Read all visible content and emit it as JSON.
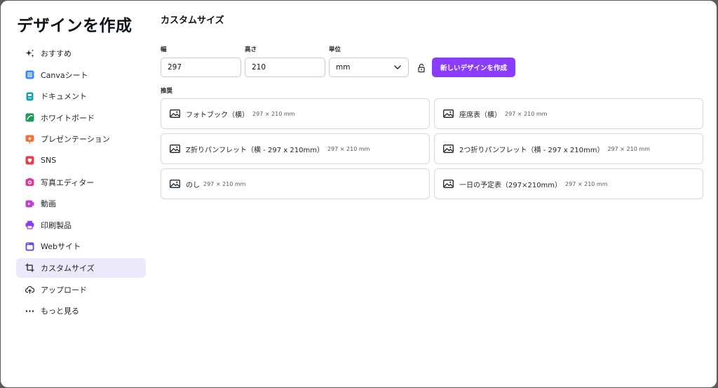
{
  "header": {
    "title": "デザインを作成"
  },
  "sidebar": {
    "items": [
      {
        "label": "おすすめ",
        "icon": "sparkle-icon",
        "color": "#1e2328"
      },
      {
        "label": "Canvaシート",
        "icon": "sheet-icon",
        "color": "#3a86ff"
      },
      {
        "label": "ドキュメント",
        "icon": "doc-icon",
        "color": "#13a3b8"
      },
      {
        "label": "ホワイトボード",
        "icon": "whiteboard-icon",
        "color": "#1e9b5a"
      },
      {
        "label": "プレゼンテーション",
        "icon": "presentation-icon",
        "color": "#f2703a"
      },
      {
        "label": "SNS",
        "icon": "heart-icon",
        "color": "#f0384e"
      },
      {
        "label": "写真エディター",
        "icon": "camera-icon",
        "color": "#e0389a"
      },
      {
        "label": "動画",
        "icon": "video-icon",
        "color": "#c23bd9"
      },
      {
        "label": "印刷製品",
        "icon": "printer-icon",
        "color": "#8b3dff"
      },
      {
        "label": "Webサイト",
        "icon": "website-icon",
        "color": "#5b4be0"
      },
      {
        "label": "カスタムサイズ",
        "icon": "crop-icon",
        "color": "#1e2328",
        "active": true
      },
      {
        "label": "アップロード",
        "icon": "cloud-upload-icon",
        "color": "#1e2328"
      },
      {
        "label": "もっと見る",
        "icon": "more-icon",
        "color": "#1e2328"
      }
    ]
  },
  "custom": {
    "title": "カスタムサイズ",
    "width_label": "幅",
    "width_value": "297",
    "height_label": "高さ",
    "height_value": "210",
    "unit_label": "単位",
    "unit_value": "mm",
    "create_label": "新しいデザインを作成",
    "recommended_label": "推奨"
  },
  "recommendations": [
    {
      "name": "フォトブック（横）",
      "size": "297 × 210 mm"
    },
    {
      "name": "座席表（横）",
      "size": "297 × 210 mm"
    },
    {
      "name": "Z折りパンフレット（横 - 297 x 210mm）",
      "size": "297 × 210 mm"
    },
    {
      "name": "2つ折りパンフレット（横 - 297 x 210mm）",
      "size": "297 × 210 mm"
    },
    {
      "name": "のし",
      "size": "297 × 210 mm"
    },
    {
      "name": "一日の予定表（297×210mm）",
      "size": "297 × 210 mm"
    }
  ],
  "colors": {
    "accent": "#8b3dff",
    "active_bg": "#ece9fb"
  }
}
